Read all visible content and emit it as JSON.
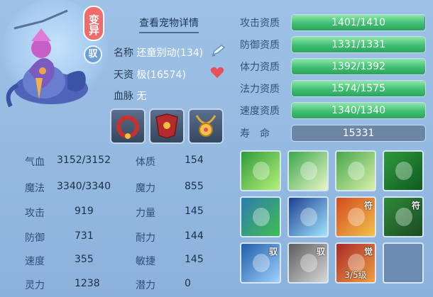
{
  "pet": {
    "variant_badge": "变异",
    "ride_badge": "驭",
    "detail_link": "查看宠物详情",
    "name_label": "名称",
    "name_value": "还童别动(134)",
    "aptitude_label": "天资",
    "aptitude_value": "极(16574)",
    "bloodline_label": "血脉",
    "bloodline_value": "无"
  },
  "stats_left": [
    {
      "label": "气血",
      "value": "3152/3152"
    },
    {
      "label": "魔法",
      "value": "3340/3340"
    },
    {
      "label": "攻击",
      "value": "919"
    },
    {
      "label": "防御",
      "value": "731"
    },
    {
      "label": "速度",
      "value": "355"
    },
    {
      "label": "灵力",
      "value": "1238"
    }
  ],
  "stats_right": [
    {
      "label": "体质",
      "value": "154"
    },
    {
      "label": "魔力",
      "value": "855"
    },
    {
      "label": "力量",
      "value": "145"
    },
    {
      "label": "耐力",
      "value": "144"
    },
    {
      "label": "敏捷",
      "value": "145"
    },
    {
      "label": "潜力",
      "value": "0"
    }
  ],
  "qualities": [
    {
      "label": "攻击资质",
      "value": "1401/1410",
      "fraction": 0.9936
    },
    {
      "label": "防御资质",
      "value": "1331/1331",
      "fraction": 1.0
    },
    {
      "label": "体力资质",
      "value": "1392/1392",
      "fraction": 1.0
    },
    {
      "label": "法力资质",
      "value": "1574/1575",
      "fraction": 0.9994
    },
    {
      "label": "速度资质",
      "value": "1340/1340",
      "fraction": 1.0
    }
  ],
  "lifespan": {
    "label": "寿　命",
    "value": "15331"
  },
  "skills": [
    {
      "icon": "figure-glow-icon",
      "tag": "",
      "level": ""
    },
    {
      "icon": "pointing-hand-icon",
      "tag": "",
      "level": ""
    },
    {
      "icon": "palm-light-icon",
      "tag": "",
      "level": ""
    },
    {
      "icon": "green-spirit-icon",
      "tag": "",
      "level": ""
    },
    {
      "icon": "muscle-man-icon",
      "tag": "",
      "level": ""
    },
    {
      "icon": "lightning-icon",
      "tag": "",
      "level": ""
    },
    {
      "icon": "talisman-sword-icon",
      "tag": "符",
      "level": ""
    },
    {
      "icon": "green-cat-icon",
      "tag": "符",
      "level": ""
    },
    {
      "icon": "shield-icon",
      "tag": "驭",
      "level": ""
    },
    {
      "icon": "smoke-rings-icon",
      "tag": "驭",
      "level": ""
    },
    {
      "icon": "awaken-figure-icon",
      "tag": "觉",
      "level": "3/5级"
    },
    {
      "icon": "empty-slot-icon",
      "tag": "",
      "level": ""
    }
  ],
  "colors": {
    "accent_green": "#3fbf72",
    "heart": "#e8505b",
    "badge_red": "#f06b6b"
  }
}
